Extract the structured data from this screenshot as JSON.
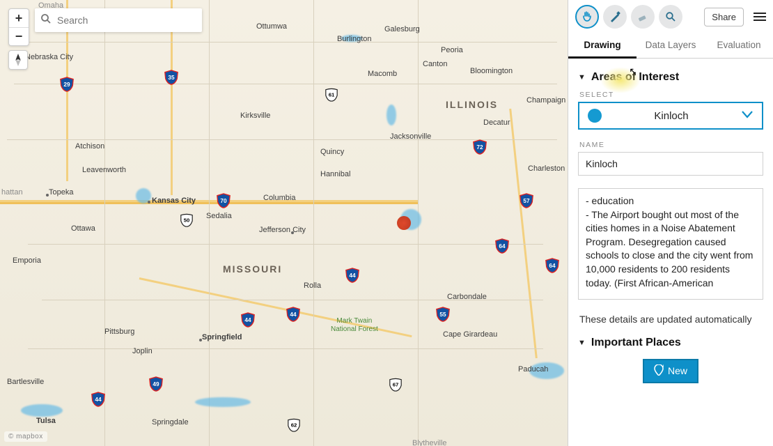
{
  "search": {
    "placeholder": "Search"
  },
  "toolbar": {
    "share": "Share"
  },
  "tabs": {
    "drawing": "Drawing",
    "data_layers": "Data Layers",
    "evaluation": "Evaluation"
  },
  "sections": {
    "aoi": {
      "title": "Areas of Interest"
    },
    "places": {
      "title": "Important Places"
    }
  },
  "aoi": {
    "select_label": "SELECT",
    "selected": "Kinloch",
    "name_label": "NAME",
    "name_value": "Kinloch",
    "notes": "- education\n- The Airport bought out most of the cities homes in a Noise Abatement Program. Desegregation caused schools to close and the city went from 10,000 residents to 200 residents today. (First African-American",
    "helper": "These details are updated automatically"
  },
  "places": {
    "new_label": "New"
  },
  "map": {
    "states": {
      "missouri": "MISSOURI",
      "illinois": "ILLINOIS"
    },
    "forest": "Mark Twain\nNational Forest",
    "attribution": "© mapbox",
    "cities": {
      "omaha": "Omaha",
      "nebraska_city": "Nebraska City",
      "atchison": "Atchison",
      "leavenworth": "Leavenworth",
      "kansas_city": "Kansas City",
      "topeka": "Topeka",
      "ottawa": "Ottawa",
      "hattan": "hattan",
      "emporia": "Emporia",
      "bartlesville": "Bartlesville",
      "tulsa": "Tulsa",
      "ottumwa": "Ottumwa",
      "kirksville": "Kirksville",
      "columbia": "Columbia",
      "jefferson_city": "Jefferson City",
      "sedalia": "Sedalia",
      "springfield": "Springfield",
      "springdale": "Springdale",
      "joplin": "Joplin",
      "pittsburg": "Pittsburg",
      "rolla": "Rolla",
      "burlington": "Burlington",
      "galesburg": "Galesburg",
      "macomb": "Macomb",
      "canton": "Canton",
      "peoria": "Peoria",
      "bloomington": "Bloomington",
      "champaign": "Champaign",
      "decatur": "Decatur",
      "jacksonville": "Jacksonville",
      "quincy": "Quincy",
      "hannibal": "Hannibal",
      "charleston": "Charleston",
      "carbondale": "Carbondale",
      "cape_girardeau": "Cape Girardeau",
      "paducah": "Paducah",
      "blytheville": "Blytheville"
    },
    "shields": {
      "i29": "29",
      "i35": "35",
      "i70": "70",
      "i44": "44",
      "i44b": "44",
      "i44c": "44",
      "i49": "49",
      "i57": "57",
      "i64": "64",
      "i72": "72",
      "i55": "55",
      "u61": "61",
      "u50": "50",
      "u67": "67",
      "u62": "62"
    }
  }
}
